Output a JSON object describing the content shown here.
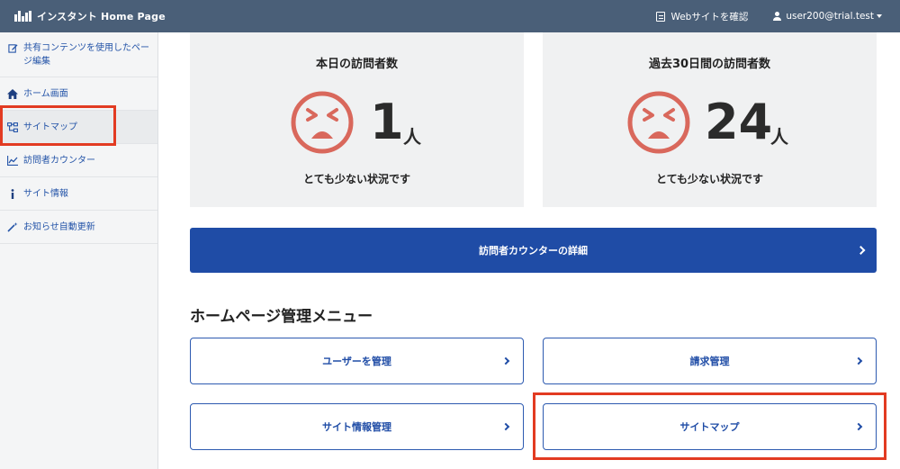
{
  "header": {
    "brand": "インスタント Home Page",
    "view_site": "Webサイトを確認",
    "user": "user200@trial.test"
  },
  "sidebar": {
    "items": [
      {
        "label": "共有コンテンツを使用したページ編集",
        "icon": "edit-icon"
      },
      {
        "label": "ホーム画面",
        "icon": "home-icon"
      },
      {
        "label": "サイトマップ",
        "icon": "sitemap-icon"
      },
      {
        "label": "訪問者カウンター",
        "icon": "chart-icon"
      },
      {
        "label": "サイト情報",
        "icon": "info-icon"
      },
      {
        "label": "お知らせ自動更新",
        "icon": "wand-icon"
      }
    ]
  },
  "stats": [
    {
      "title": "本日の訪問者数",
      "count": "1",
      "unit": "人",
      "status": "とても少ない状況です"
    },
    {
      "title": "過去30日間の訪問者数",
      "count": "24",
      "unit": "人",
      "status": "とても少ない状況です"
    }
  ],
  "detail_button": "訪問者カウンターの詳細",
  "menu": {
    "title": "ホームページ管理メニュー",
    "items": [
      "ユーザーを管理",
      "請求管理",
      "サイト情報管理",
      "サイトマップ"
    ]
  },
  "colors": {
    "header_bg": "#4a5f78",
    "primary": "#1f4ca6",
    "face": "#d9685c",
    "highlight": "#e23b22"
  }
}
